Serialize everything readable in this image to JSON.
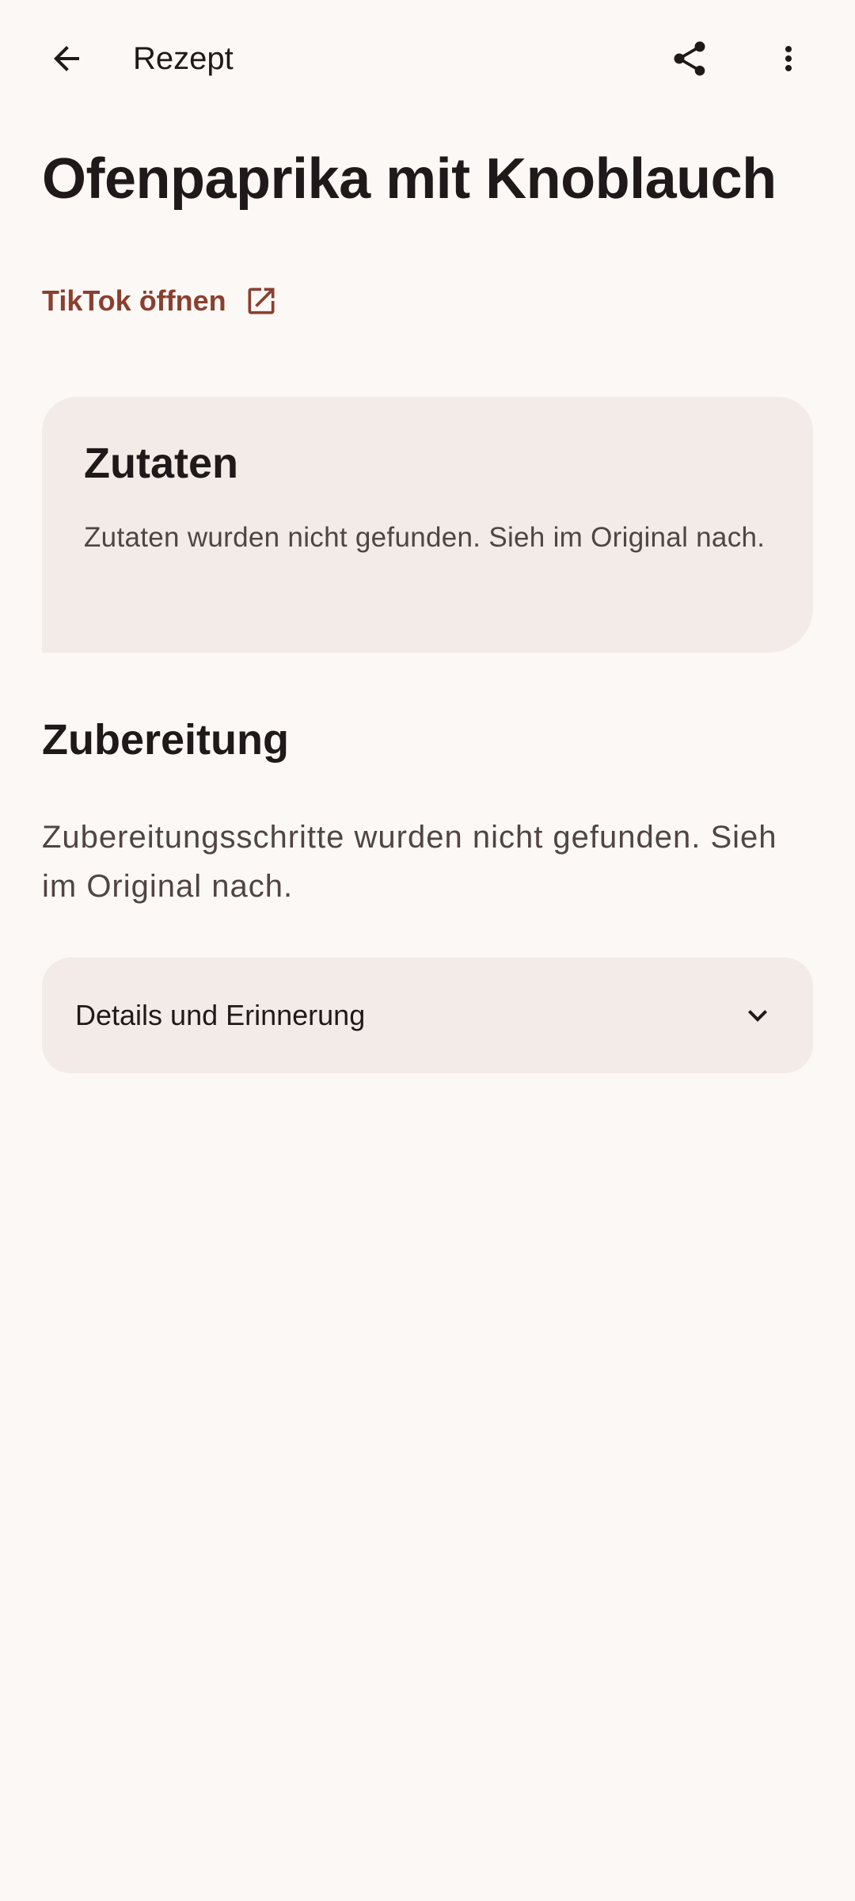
{
  "app_bar": {
    "title": "Rezept",
    "back_icon": "arrow-back-icon",
    "share_icon": "share-icon",
    "more_icon": "more-vert-icon"
  },
  "recipe": {
    "title": "Ofenpaprika mit Knoblauch",
    "source_link_label": "TikTok öffnen",
    "source_link_icon": "open-in-new-icon"
  },
  "ingredients": {
    "heading": "Zutaten",
    "empty_text": "Zutaten wurden nicht gefunden. Sieh im Original nach."
  },
  "preparation": {
    "heading": "Zubereitung",
    "empty_text": "Zubereitungsschritte wurden nicht gefunden. Sieh im Original nach."
  },
  "details": {
    "label": "Details und Erinnerung",
    "chevron_icon": "chevron-down-icon"
  },
  "colors": {
    "background": "#fcf8f5",
    "card": "#f3ebe7",
    "accent": "#8b3f2f",
    "text_primary": "#1f1a19",
    "text_secondary": "#4f4543"
  }
}
